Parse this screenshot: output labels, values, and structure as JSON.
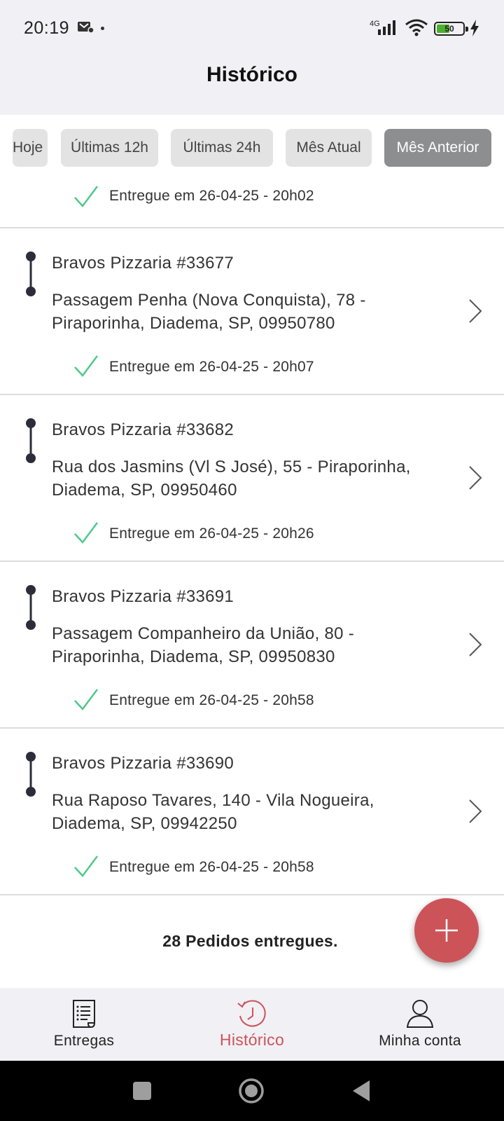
{
  "status_bar": {
    "time": "20:19",
    "network": "4G",
    "battery": "50"
  },
  "header": {
    "title": "Histórico"
  },
  "filters": [
    {
      "label": "Hoje",
      "active": false
    },
    {
      "label": "Últimas 12h",
      "active": false
    },
    {
      "label": "Últimas 24h",
      "active": false
    },
    {
      "label": "Mês Atual",
      "active": false
    },
    {
      "label": "Mês Anterior",
      "active": true
    }
  ],
  "partial_entry": {
    "delivered": "Entregue em 26-04-25 - 20h02"
  },
  "orders": [
    {
      "name": "Bravos Pizzaria #33677",
      "address": "Passagem Penha (Nova Conquista), 78 - Piraporinha, Diadema, SP, 09950780",
      "delivered": "Entregue em 26-04-25 - 20h07"
    },
    {
      "name": "Bravos Pizzaria #33682",
      "address": "Rua dos Jasmins (Vl S José), 55 - Piraporinha, Diadema, SP, 09950460",
      "delivered": "Entregue em 26-04-25 - 20h26"
    },
    {
      "name": "Bravos Pizzaria #33691",
      "address": "Passagem Companheiro da União, 80 - Piraporinha, Diadema, SP, 09950830",
      "delivered": "Entregue em 26-04-25 - 20h58"
    },
    {
      "name": "Bravos Pizzaria #33690",
      "address": "Rua Raposo Tavares, 140 - Vila Nogueira, Diadema, SP, 09942250",
      "delivered": "Entregue em 26-04-25 - 20h58"
    }
  ],
  "summary": "28 Pedidos entregues.",
  "bottom_nav": {
    "items": [
      {
        "label": "Entregas",
        "icon": "document-list-icon"
      },
      {
        "label": "Histórico",
        "icon": "history-clock-icon",
        "active": true
      },
      {
        "label": "Minha conta",
        "icon": "user-icon"
      }
    ]
  },
  "colors": {
    "accent": "#cc5459",
    "check": "#4fc98a",
    "active_chip": "#8d8e90",
    "chip": "#e3e3e3"
  }
}
